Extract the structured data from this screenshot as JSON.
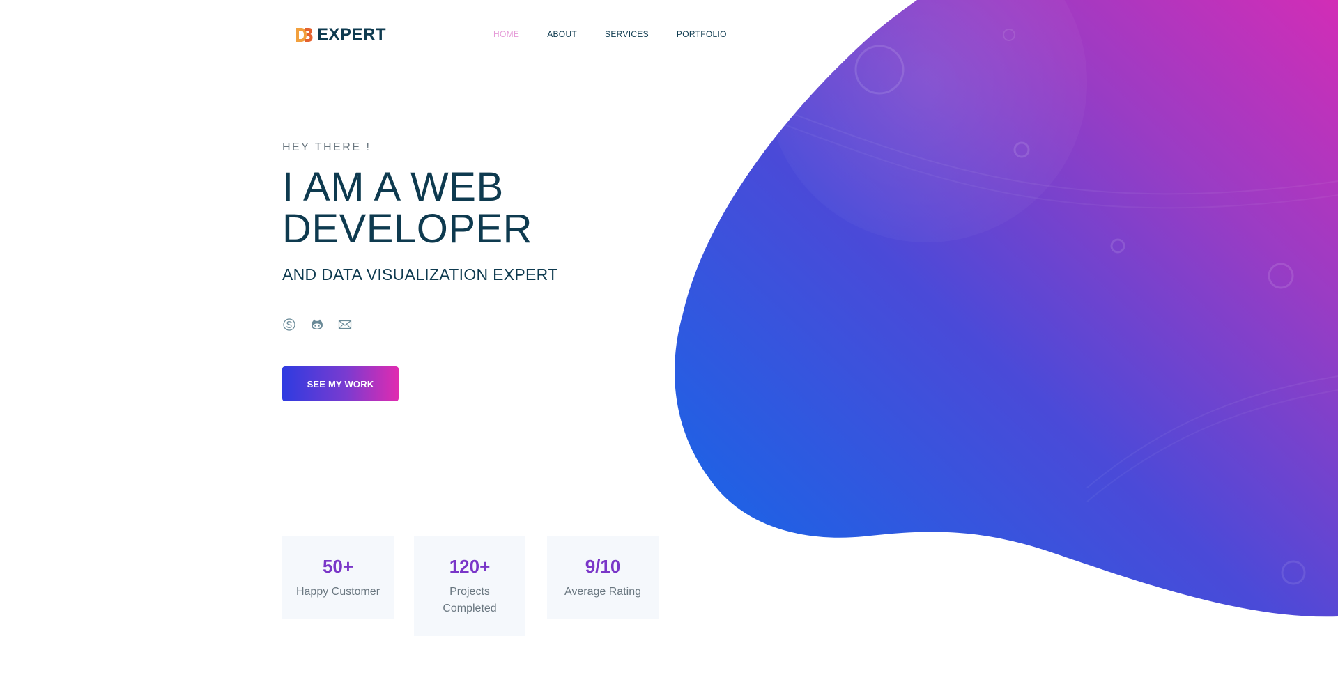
{
  "brand": {
    "name": "EXPERT",
    "logo_icon": "db-logo-icon",
    "logo_colors": [
      "#f2a03d",
      "#e4622f"
    ]
  },
  "nav": {
    "items": [
      {
        "label": "HOME",
        "active": true
      },
      {
        "label": "ABOUT",
        "active": false
      },
      {
        "label": "SERVICES",
        "active": false
      },
      {
        "label": "PORTFOLIO",
        "active": false
      }
    ]
  },
  "hero": {
    "greeting": "HEY THERE !",
    "headline_line1": "I AM A WEB",
    "headline_line2": "DEVELOPER",
    "subheadline": "AND DATA VISUALIZATION EXPERT",
    "socials": [
      {
        "icon": "skype-icon"
      },
      {
        "icon": "github-icon"
      },
      {
        "icon": "mail-icon"
      }
    ],
    "cta_label": "SEE MY WORK"
  },
  "stats": [
    {
      "value": "50+",
      "label": "Happy Customer"
    },
    {
      "value": "120+",
      "label": "Projects Completed"
    },
    {
      "value": "9/10",
      "label": "Average Rating"
    }
  ],
  "colors": {
    "text": "#0e3a4f",
    "nav_active": "#e59ad7",
    "gradient_start": "#1565e8",
    "gradient_end": "#c532b8",
    "stat_value": "#7a36c8",
    "stat_bg": "#f5f8fc"
  }
}
